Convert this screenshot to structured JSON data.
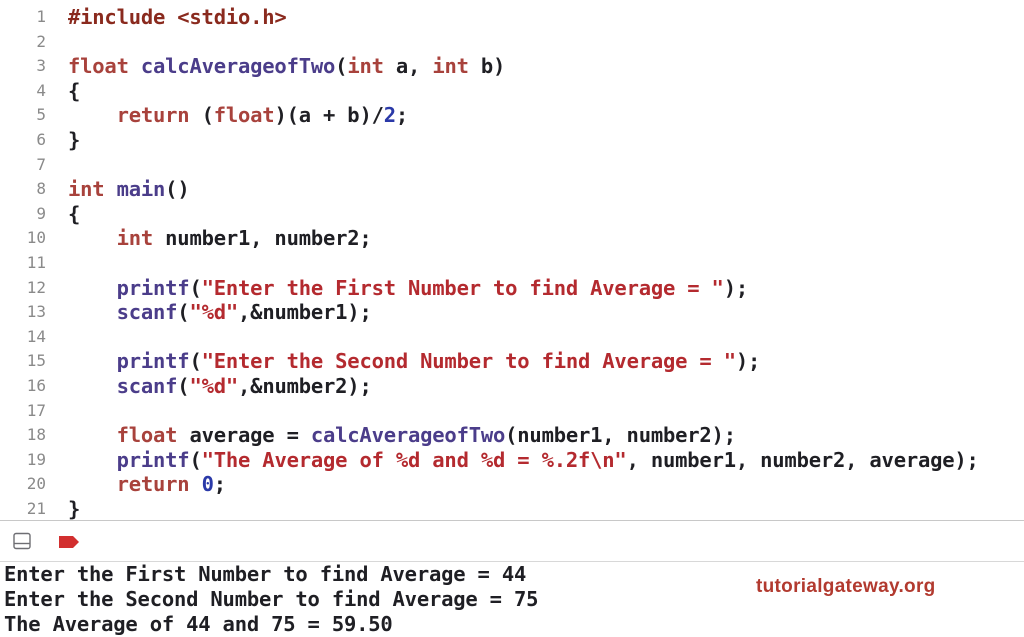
{
  "editor": {
    "lines": [
      {
        "n": "1",
        "tokens": [
          {
            "t": "pp",
            "v": "#include <stdio.h>"
          }
        ]
      },
      {
        "n": "2",
        "tokens": []
      },
      {
        "n": "3",
        "tokens": [
          {
            "t": "kw",
            "v": "float"
          },
          {
            "t": "pl",
            "v": " "
          },
          {
            "t": "fn",
            "v": "calcAverageofTwo"
          },
          {
            "t": "pl",
            "v": "("
          },
          {
            "t": "kw",
            "v": "int"
          },
          {
            "t": "pl",
            "v": " a, "
          },
          {
            "t": "kw",
            "v": "int"
          },
          {
            "t": "pl",
            "v": " b)"
          }
        ]
      },
      {
        "n": "4",
        "tokens": [
          {
            "t": "pl",
            "v": "{"
          }
        ]
      },
      {
        "n": "5",
        "tokens": [
          {
            "t": "pl",
            "v": "    "
          },
          {
            "t": "kw",
            "v": "return"
          },
          {
            "t": "pl",
            "v": " ("
          },
          {
            "t": "kw",
            "v": "float"
          },
          {
            "t": "pl",
            "v": ")(a + b)/"
          },
          {
            "t": "num",
            "v": "2"
          },
          {
            "t": "pl",
            "v": ";"
          }
        ]
      },
      {
        "n": "6",
        "tokens": [
          {
            "t": "pl",
            "v": "}"
          }
        ]
      },
      {
        "n": "7",
        "tokens": []
      },
      {
        "n": "8",
        "tokens": [
          {
            "t": "kw",
            "v": "int"
          },
          {
            "t": "pl",
            "v": " "
          },
          {
            "t": "fn",
            "v": "main"
          },
          {
            "t": "pl",
            "v": "()"
          }
        ]
      },
      {
        "n": "9",
        "tokens": [
          {
            "t": "pl",
            "v": "{"
          }
        ]
      },
      {
        "n": "10",
        "tokens": [
          {
            "t": "pl",
            "v": "    "
          },
          {
            "t": "kw",
            "v": "int"
          },
          {
            "t": "pl",
            "v": " number1, number2;"
          }
        ]
      },
      {
        "n": "11",
        "tokens": []
      },
      {
        "n": "12",
        "tokens": [
          {
            "t": "pl",
            "v": "    "
          },
          {
            "t": "fn",
            "v": "printf"
          },
          {
            "t": "pl",
            "v": "("
          },
          {
            "t": "str",
            "v": "\"Enter the First Number to find Average = \""
          },
          {
            "t": "pl",
            "v": ");"
          }
        ]
      },
      {
        "n": "13",
        "tokens": [
          {
            "t": "pl",
            "v": "    "
          },
          {
            "t": "fn",
            "v": "scanf"
          },
          {
            "t": "pl",
            "v": "("
          },
          {
            "t": "str",
            "v": "\"%d\""
          },
          {
            "t": "pl",
            "v": ",&number1);"
          }
        ]
      },
      {
        "n": "14",
        "tokens": []
      },
      {
        "n": "15",
        "tokens": [
          {
            "t": "pl",
            "v": "    "
          },
          {
            "t": "fn",
            "v": "printf"
          },
          {
            "t": "pl",
            "v": "("
          },
          {
            "t": "str",
            "v": "\"Enter the Second Number to find Average = \""
          },
          {
            "t": "pl",
            "v": ");"
          }
        ]
      },
      {
        "n": "16",
        "tokens": [
          {
            "t": "pl",
            "v": "    "
          },
          {
            "t": "fn",
            "v": "scanf"
          },
          {
            "t": "pl",
            "v": "("
          },
          {
            "t": "str",
            "v": "\"%d\""
          },
          {
            "t": "pl",
            "v": ",&number2);"
          }
        ]
      },
      {
        "n": "17",
        "tokens": []
      },
      {
        "n": "18",
        "tokens": [
          {
            "t": "pl",
            "v": "    "
          },
          {
            "t": "kw",
            "v": "float"
          },
          {
            "t": "pl",
            "v": " average = "
          },
          {
            "t": "fn",
            "v": "calcAverageofTwo"
          },
          {
            "t": "pl",
            "v": "(number1, number2);"
          }
        ]
      },
      {
        "n": "19",
        "tokens": [
          {
            "t": "pl",
            "v": "    "
          },
          {
            "t": "fn",
            "v": "printf"
          },
          {
            "t": "pl",
            "v": "("
          },
          {
            "t": "str",
            "v": "\"The Average of %d and %d = %.2f\\n\""
          },
          {
            "t": "pl",
            "v": ", number1, number2, average);"
          }
        ]
      },
      {
        "n": "20",
        "tokens": [
          {
            "t": "pl",
            "v": "    "
          },
          {
            "t": "kw",
            "v": "return"
          },
          {
            "t": "pl",
            "v": " "
          },
          {
            "t": "num",
            "v": "0"
          },
          {
            "t": "pl",
            "v": ";"
          }
        ]
      },
      {
        "n": "21",
        "tokens": [
          {
            "t": "pl",
            "v": "}"
          }
        ]
      }
    ]
  },
  "console": {
    "toggle_icon": "panel-toggle-icon",
    "breakpoint_icon": "breakpoint-icon",
    "output": [
      "Enter the First Number to find Average = 44",
      "Enter the Second Number to find Average = 75",
      "The Average of 44 and 75 = 59.50"
    ]
  },
  "watermark": "tutorialgateway.org",
  "colors": {
    "keyword": "#a8423c",
    "string": "#b42a2f",
    "function": "#4b3d8a",
    "number": "#2a39a8",
    "watermark": "#b23a2f"
  }
}
